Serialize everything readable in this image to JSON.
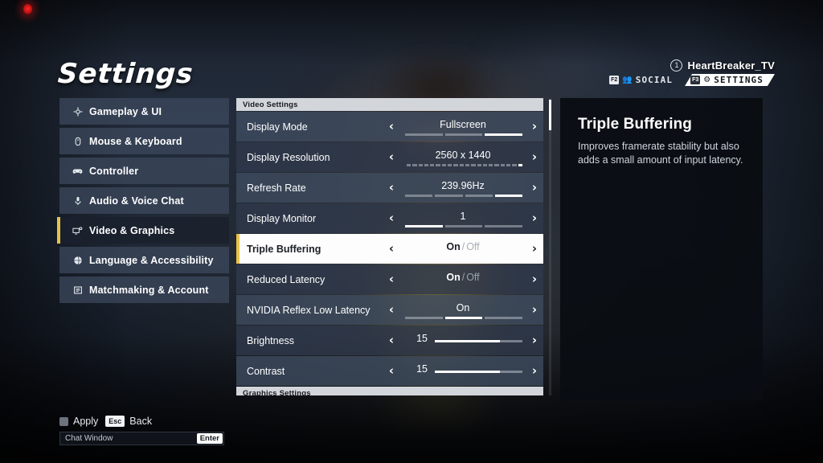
{
  "page_title": "Settings",
  "accent_color": "#e8c34a",
  "hud": {
    "player_slot": "1",
    "player_name": "HeartBreaker_TV",
    "tabs": [
      {
        "key": "F2",
        "icon": "social-icon",
        "label": "SOCIAL",
        "active": false
      },
      {
        "key": "F3",
        "icon": "gear-icon",
        "label": "SETTINGS",
        "active": true
      }
    ]
  },
  "sidebar": {
    "items": [
      {
        "label": "Gameplay & UI",
        "icon": "crosshair-icon",
        "selected": false
      },
      {
        "label": "Mouse & Keyboard",
        "icon": "mouse-icon",
        "selected": false
      },
      {
        "label": "Controller",
        "icon": "gamepad-icon",
        "selected": false
      },
      {
        "label": "Audio & Voice Chat",
        "icon": "microphone-icon",
        "selected": false
      },
      {
        "label": "Video & Graphics",
        "icon": "monitor-icon",
        "selected": true
      },
      {
        "label": "Language & Accessibility",
        "icon": "globe-icon",
        "selected": false
      },
      {
        "label": "Matchmaking & Account",
        "icon": "list-icon",
        "selected": false
      }
    ]
  },
  "panel": {
    "sections": [
      {
        "header": "Video Settings"
      },
      {
        "header": "Graphics Settings"
      }
    ],
    "rows": [
      {
        "label": "Display Mode",
        "value": "Fullscreen",
        "control": "segments",
        "segments": 3,
        "active_segment": 3,
        "highlight": false
      },
      {
        "label": "Display Resolution",
        "value": "2560 x 1440",
        "control": "dots",
        "segments": 20,
        "active_segment": 20,
        "highlight": false
      },
      {
        "label": "Refresh Rate",
        "value": "239.96Hz",
        "control": "segments",
        "segments": 4,
        "active_segment": 4,
        "highlight": false
      },
      {
        "label": "Display Monitor",
        "value": "1",
        "control": "segments",
        "segments": 3,
        "active_segment": 1,
        "highlight": false
      },
      {
        "label": "Triple Buffering",
        "value_on": "On",
        "value_sep": "/",
        "value_off": "Off",
        "control": "toggle",
        "highlight": true
      },
      {
        "label": "Reduced Latency",
        "value_on": "On",
        "value_sep": "/",
        "value_off": "Off",
        "control": "toggle",
        "highlight": false
      },
      {
        "label": "NVIDIA Reflex Low Latency",
        "value": "On",
        "control": "segments",
        "segments": 3,
        "active_segment": 2,
        "highlight": false
      },
      {
        "label": "Brightness",
        "value": "15",
        "control": "slider",
        "fill_percent": 74,
        "highlight": false
      },
      {
        "label": "Contrast",
        "value": "15",
        "control": "slider",
        "fill_percent": 74,
        "highlight": false
      }
    ],
    "arrow_left": "‹",
    "arrow_right": "›"
  },
  "description": {
    "title": "Triple Buffering",
    "body": "Improves framerate stability but also adds a small amount of input latency."
  },
  "bottom": {
    "apply_key": "",
    "apply_label": "Apply",
    "back_key": "Esc",
    "back_label": "Back",
    "chat_placeholder": "Chat Window",
    "chat_key": "Enter"
  }
}
